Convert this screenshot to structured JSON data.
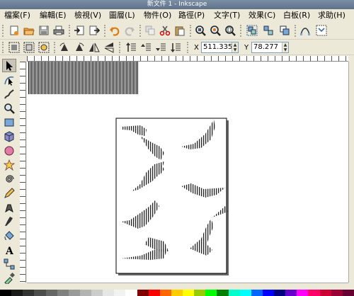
{
  "window": {
    "title": "新文件 1 - Inkscape"
  },
  "menu": [
    "檔案(F)",
    "編輯(E)",
    "檢視(V)",
    "圖層(L)",
    "物件(O)",
    "路徑(P)",
    "文字(T)",
    "效果(C)",
    "白板(R)",
    "求助(H)"
  ],
  "coords": {
    "x_label": "X",
    "x_value": "511.335",
    "y_label": "Y",
    "y_value": "78.277"
  },
  "command_icons": [
    "new-document-icon",
    "open-icon",
    "save-icon",
    "print-icon",
    "import-icon",
    "export-icon",
    "undo-icon",
    "redo-icon",
    "duplicate-icon",
    "cut-icon",
    "paste-icon",
    "zoom-selection-icon",
    "zoom-drawing-icon",
    "zoom-page-icon",
    "group-icon",
    "ungroup-icon",
    "clone-icon",
    "node-editor-icon",
    "xml-editor-icon"
  ],
  "control_icons": [
    "select-all-icon",
    "select-in-layer-icon",
    "deselect-icon",
    "rotate-ccw-icon",
    "rotate-cw-icon",
    "flip-horizontal-icon",
    "flip-vertical-icon",
    "raise-to-top-icon",
    "raise-icon",
    "lower-icon",
    "lower-to-bottom-icon"
  ],
  "tools": [
    "selector-tool-icon",
    "node-tool-icon",
    "tweak-tool-icon",
    "zoom-tool-icon",
    "rectangle-tool-icon",
    "3dbox-tool-icon",
    "ellipse-tool-icon",
    "star-tool-icon",
    "spiral-tool-icon",
    "pencil-tool-icon",
    "pen-tool-icon",
    "calligraphy-tool-icon",
    "paint-bucket-tool-icon",
    "text-tool-icon",
    "connector-tool-icon",
    "dropper-tool-icon",
    "gradient-tool-icon"
  ],
  "palette": [
    "#000000",
    "#1a1a1a",
    "#333333",
    "#4d4d4d",
    "#666666",
    "#808080",
    "#999999",
    "#b3b3b3",
    "#cccccc",
    "#e6e6e6",
    "#f2f2f2",
    "#ffffff",
    "#800000",
    "#ff0000",
    "#ff6600",
    "#ffcc00",
    "#ffff00",
    "#99cc00",
    "#00ff00",
    "#008000",
    "#00ffcc",
    "#00ffff",
    "#0066ff",
    "#0000ff",
    "#000080",
    "#6600cc",
    "#ff00ff",
    "#ff0066",
    "#cc0033",
    "#990033",
    "#660033"
  ]
}
